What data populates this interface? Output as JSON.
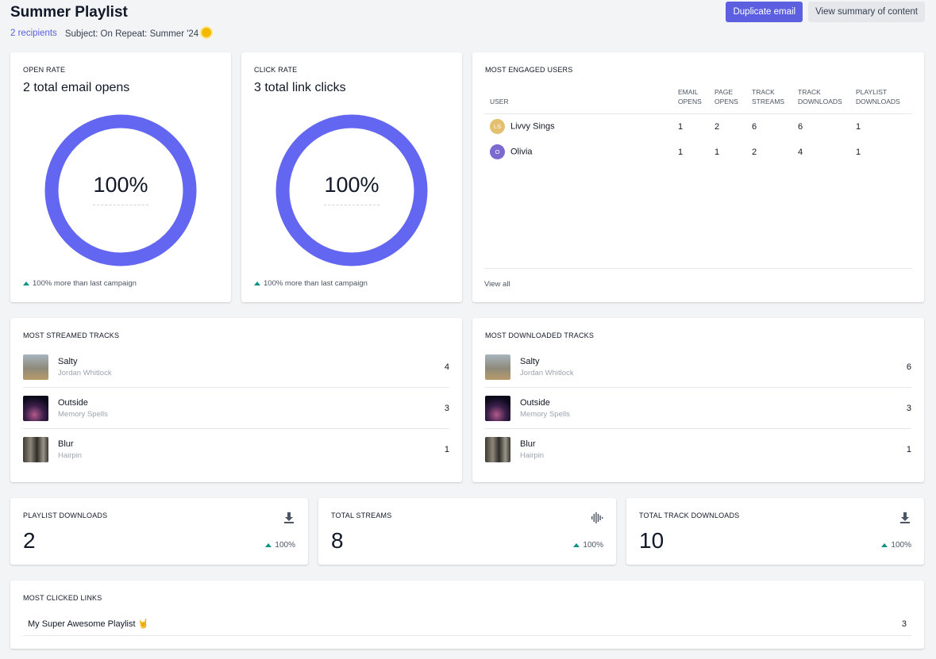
{
  "header": {
    "title": "Summer Playlist",
    "recipients": "2 recipients",
    "subject": "Subject: On Repeat: Summer '24",
    "duplicate_label": "Duplicate email",
    "summary_label": "View summary of content"
  },
  "open_rate": {
    "label": "OPEN RATE",
    "total": "2 total email opens",
    "percent": "100%",
    "trend": "100% more than last campaign",
    "fraction": 1.0
  },
  "click_rate": {
    "label": "CLICK RATE",
    "total": "3 total link clicks",
    "percent": "100%",
    "trend": "100% more than last campaign",
    "fraction": 1.0
  },
  "engaged": {
    "label": "MOST ENGAGED USERS",
    "columns": [
      "USER",
      "EMAIL OPENS",
      "PAGE OPENS",
      "TRACK STREAMS",
      "TRACK DOWNLOADS",
      "PLAYLIST DOWNLOADS"
    ],
    "rows": [
      {
        "initials": "LS",
        "name": "Livvy Sings",
        "color": "#e3c06f",
        "values": [
          "1",
          "2",
          "6",
          "6",
          "1"
        ]
      },
      {
        "initials": "O",
        "name": "Olivia",
        "color": "#7c6ad1",
        "values": [
          "1",
          "1",
          "2",
          "4",
          "1"
        ]
      }
    ],
    "view_all": "View all"
  },
  "streamed": {
    "label": "MOST STREAMED TRACKS",
    "tracks": [
      {
        "name": "Salty",
        "artist": "Jordan Whitlock",
        "count": "4"
      },
      {
        "name": "Outside",
        "artist": "Memory Spells",
        "count": "3"
      },
      {
        "name": "Blur",
        "artist": "Hairpin",
        "count": "1"
      }
    ]
  },
  "downloaded": {
    "label": "MOST DOWNLOADED TRACKS",
    "tracks": [
      {
        "name": "Salty",
        "artist": "Jordan Whitlock",
        "count": "6"
      },
      {
        "name": "Outside",
        "artist": "Memory Spells",
        "count": "3"
      },
      {
        "name": "Blur",
        "artist": "Hairpin",
        "count": "1"
      }
    ]
  },
  "stats": {
    "playlist_downloads": {
      "label": "PLAYLIST DOWNLOADS",
      "value": "2",
      "trend": "100%",
      "icon": "download-icon"
    },
    "total_streams": {
      "label": "TOTAL STREAMS",
      "value": "8",
      "trend": "100%",
      "icon": "waveform-icon"
    },
    "total_track_downloads": {
      "label": "TOTAL TRACK DOWNLOADS",
      "value": "10",
      "trend": "100%",
      "icon": "download-icon"
    }
  },
  "links": {
    "label": "MOST CLICKED LINKS",
    "items": [
      {
        "name": "My Super Awesome Playlist",
        "count": "3"
      }
    ]
  },
  "colors": {
    "accent": "#5b5fe0",
    "donut": "#6366f1",
    "trend_up": "#0d9488"
  }
}
